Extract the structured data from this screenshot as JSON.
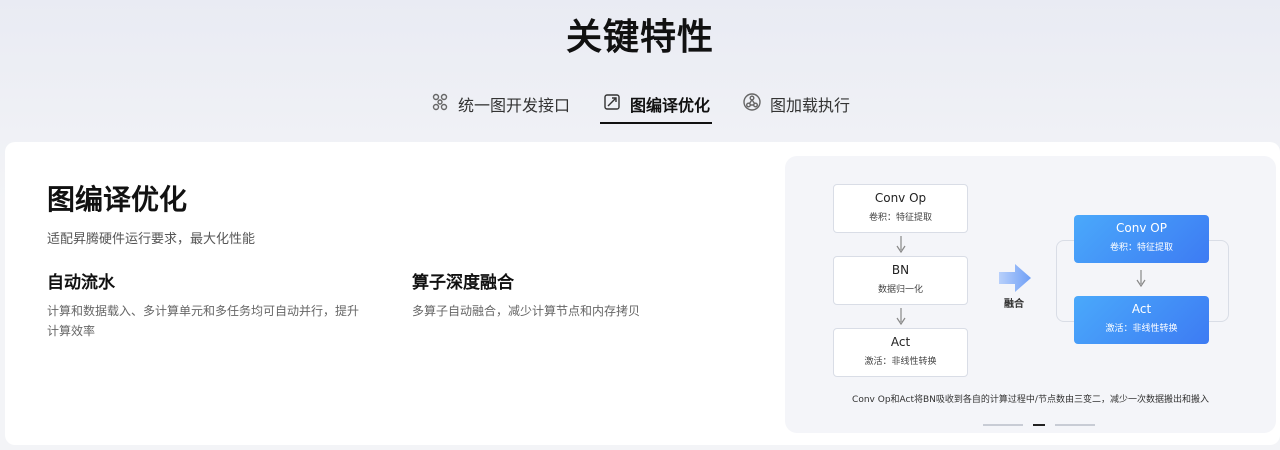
{
  "section": {
    "title": "关键特性"
  },
  "tabs": [
    {
      "label": "统一图开发接口",
      "icon": "graph-nodes-icon",
      "active": false
    },
    {
      "label": "图编译优化",
      "icon": "compile-icon",
      "active": true
    },
    {
      "label": "图加载执行",
      "icon": "load-execute-icon",
      "active": false
    }
  ],
  "panel": {
    "title": "图编译优化",
    "subtitle": "适配昇腾硬件运行要求，最大化性能",
    "features": [
      {
        "title": "自动流水",
        "desc": "计算和数据载入、多计算单元和多任务均可自动并行，提升计算效率"
      },
      {
        "title": "算子深度融合",
        "desc": "多算子自动融合，减少计算节点和内存拷贝"
      }
    ]
  },
  "diagram": {
    "left_boxes": [
      {
        "title": "Conv Op",
        "sub": "卷积：特征提取"
      },
      {
        "title": "BN",
        "sub": "数据归一化"
      },
      {
        "title": "Act",
        "sub": "激活：非线性转换"
      }
    ],
    "merge_label": "融合",
    "right_boxes": [
      {
        "title": "Conv OP",
        "sub": "卷积：特征提取"
      },
      {
        "title": "Act",
        "sub": "激活：非线性转换"
      }
    ],
    "caption": "Conv Op和Act将BN吸收到各自的计算过程中/节点数由三变二，减少一次数据搬出和搬入",
    "pager": {
      "total": 3,
      "active_index": 1
    },
    "colors": {
      "fused_start": "#4aa9fb",
      "fused_end": "#3d7bf3",
      "arrow": "#7aa6f7"
    }
  }
}
